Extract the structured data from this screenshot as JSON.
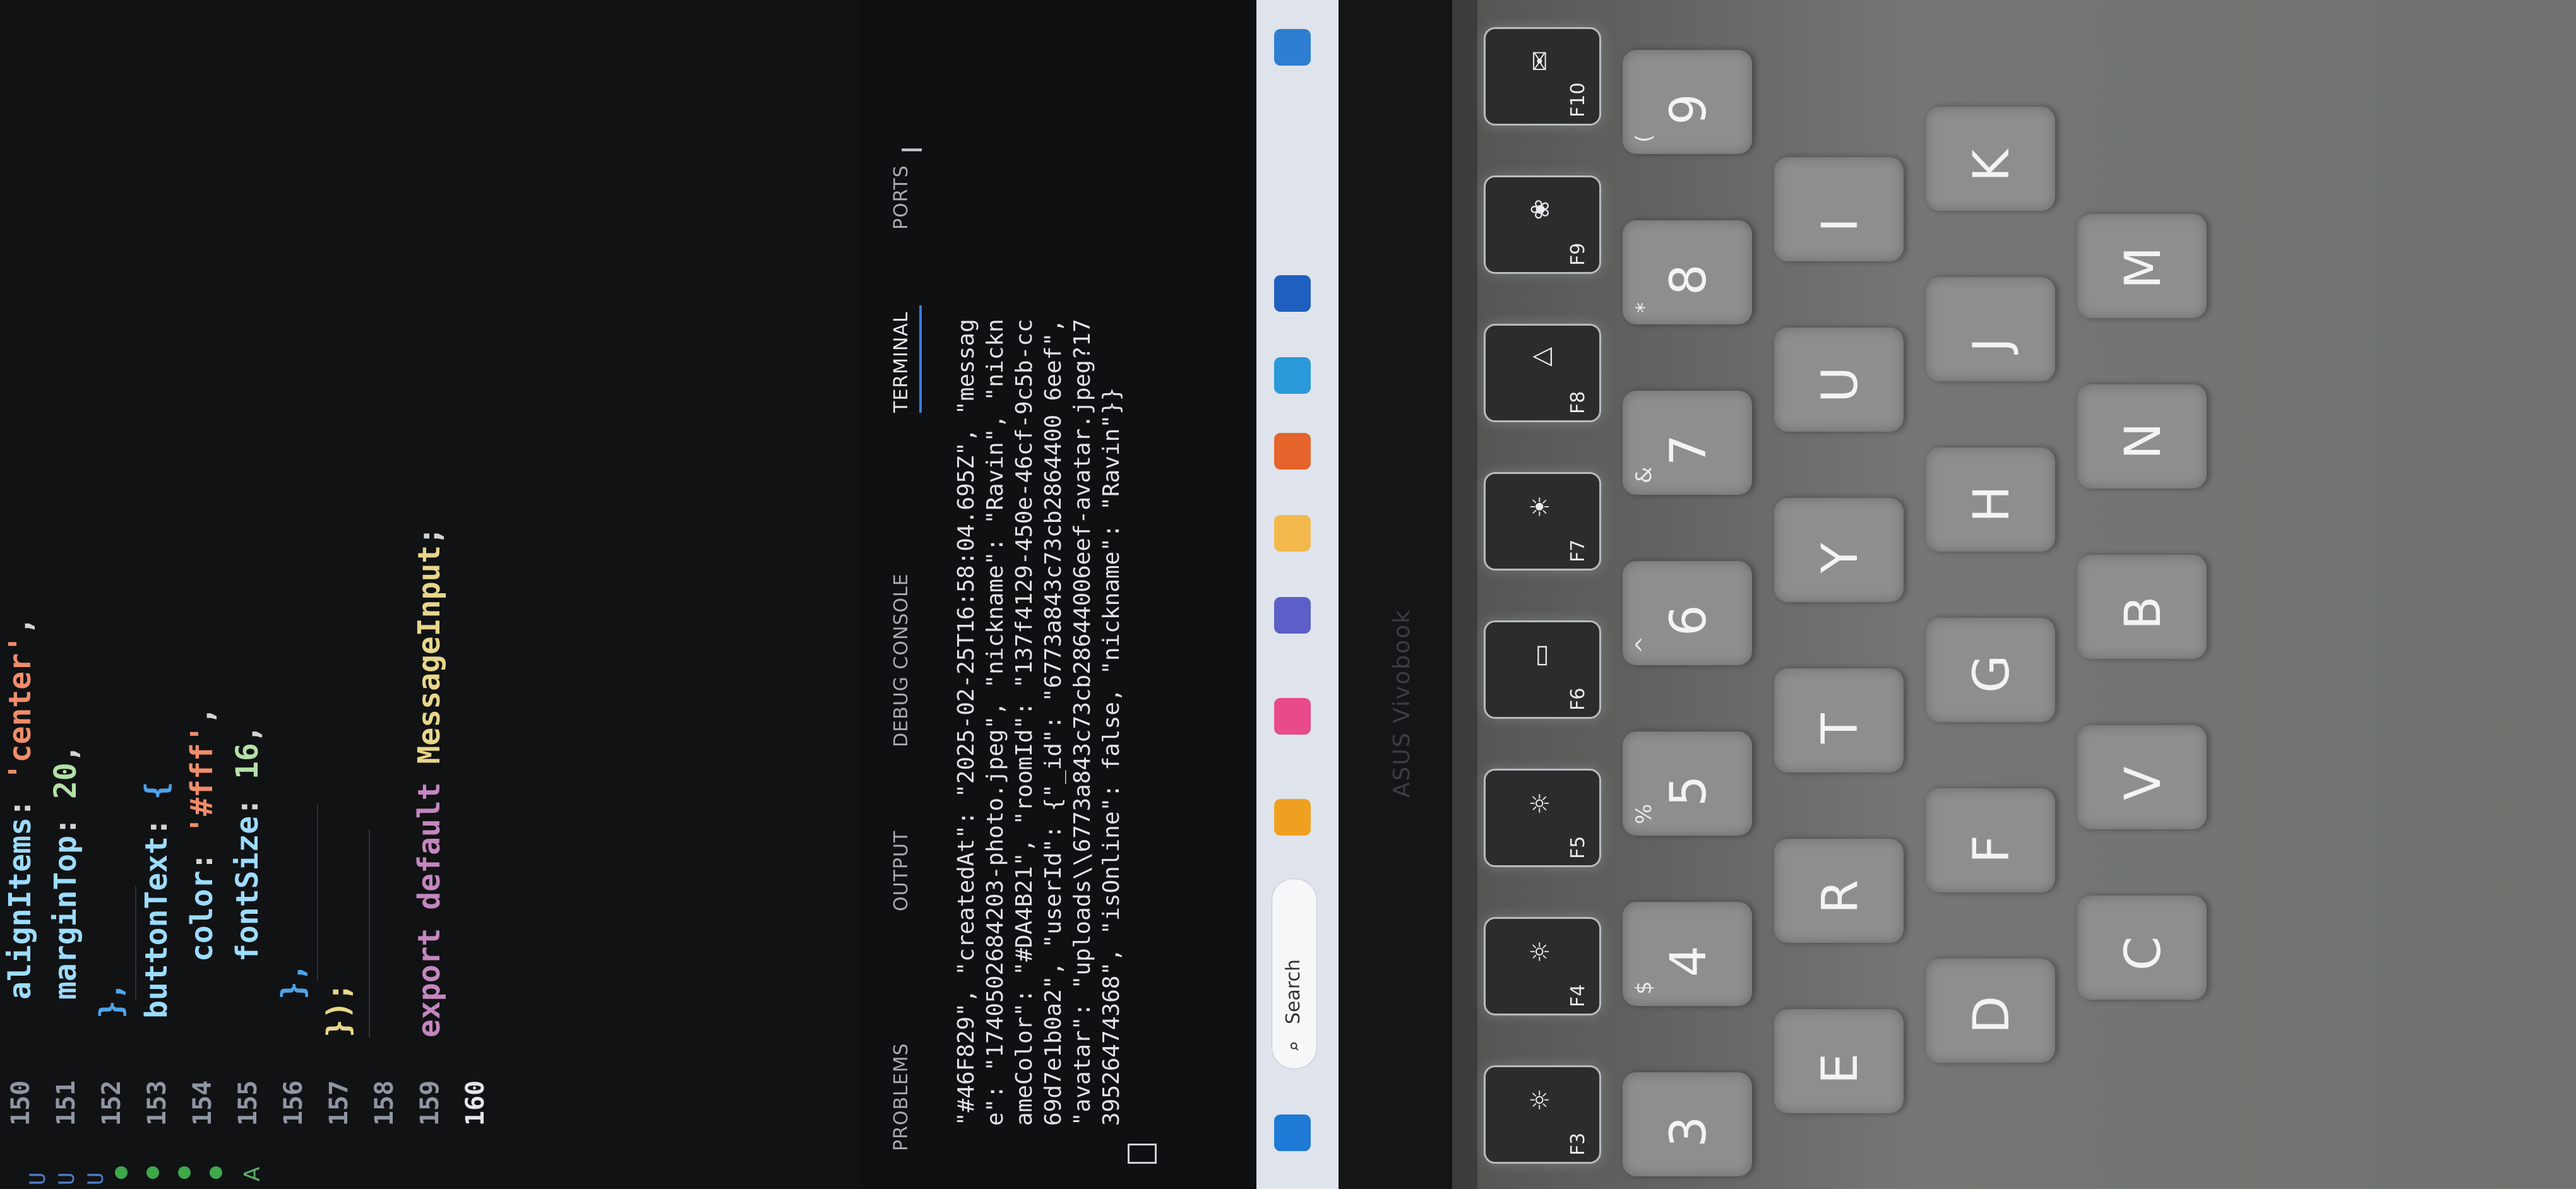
{
  "editor": {
    "line_numbers": [
      "150",
      "151",
      "152",
      "153",
      "154",
      "155",
      "156",
      "157",
      "158",
      "159",
      "160"
    ],
    "active_line": "160",
    "lines": {
      "l150_prop": "alignItems",
      "l150_val": "'center'",
      "l151_prop": "marginTop",
      "l151_val": "20",
      "l152": "},",
      "l153_prop": "buttonText",
      "l153_open": "{",
      "l154_prop": "color",
      "l154_val": "'#fff'",
      "l155_prop": "fontSize",
      "l155_val": "16",
      "l156": "},",
      "l157": "});",
      "l159_kw": "export default",
      "l159_name": "MessageInput",
      "l159_end": ";"
    },
    "gutter_glyphs": [
      "U",
      "U",
      "U"
    ],
    "gutter_letter": "A"
  },
  "panel": {
    "tabs": [
      "PROBLEMS",
      "OUTPUT",
      "DEBUG CONSOLE",
      "TERMINAL",
      "PORTS"
    ],
    "active_tab": "TERMINAL",
    "terminal_lines": [
      "\"#46F829\", \"createdAt\": \"2025-02-25T16:58:04.695Z\", \"messag",
      "e\": \"1740502684203-photo.jpeg\", \"nickname\": \"Ravin\", \"nickn",
      "ameColor\": \"#DA4B21\", \"roomId\": \"137f4129-450e-46cf-9c5b-cc",
      "69d7e1b0a2\", \"userId\": {\"_id\": \"6773a843c73cb2864400 6eef\",",
      "\"avatar\": \"uploads\\\\6773a843c73cb28644006eef-avatar.jpeg?17",
      "39526474368\", \"isOnline\": false, \"nickname\": \"Ravin\"}}"
    ],
    "text_cursor": "I"
  },
  "taskbar": {
    "search_label": "Search",
    "search_icon": "magnifier-icon",
    "apps": [
      "windows-start-icon",
      "widgets-icon",
      "copilot-icon",
      "teams-icon",
      "file-explorer-icon",
      "firefox-icon",
      "edge-icon",
      "store-icon",
      "vscode-icon"
    ]
  },
  "laptop": {
    "brand": "ASUS Vivobook"
  },
  "keyboard": {
    "function_keys": [
      "F3",
      "F4",
      "F5",
      "F6",
      "F7",
      "F8",
      "F9",
      "F10"
    ],
    "number_row": [
      {
        "main": "3",
        "shift": ""
      },
      {
        "main": "4",
        "shift": "$"
      },
      {
        "main": "5",
        "shift": "%"
      },
      {
        "main": "6",
        "shift": "^"
      },
      {
        "main": "7",
        "shift": "&"
      },
      {
        "main": "8",
        "shift": "*"
      },
      {
        "main": "9",
        "shift": "("
      }
    ],
    "top_row": [
      "E",
      "R",
      "T",
      "Y",
      "U",
      "I"
    ],
    "home_row": [
      "D",
      "F",
      "G",
      "H",
      "J",
      "K"
    ],
    "bottom_row": [
      "C",
      "V",
      "B",
      "N",
      "M"
    ]
  },
  "colors": {
    "editor_bg": "#111214",
    "property": "#9cdcfe",
    "string": "#f08d6a",
    "number": "#b5e0a8",
    "keyword": "#c586c0",
    "accent": "#3a7be0"
  }
}
